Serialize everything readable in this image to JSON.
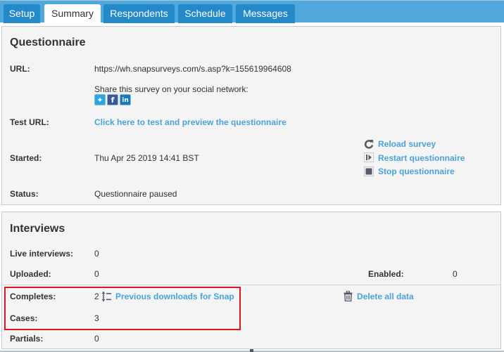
{
  "tabs": [
    {
      "label": "Setup",
      "active": false
    },
    {
      "label": "Summary",
      "active": true
    },
    {
      "label": "Respondents",
      "active": false
    },
    {
      "label": "Schedule",
      "active": false
    },
    {
      "label": "Messages",
      "active": false
    }
  ],
  "questionnaire": {
    "title": "Questionnaire",
    "url_label": "URL:",
    "url_value": "https://wh.snapsurveys.com/s.asp?k=155619964608",
    "share_text": "Share this survey on your social network:",
    "social": [
      "twitter-icon",
      "facebook-icon",
      "linkedin-icon"
    ],
    "test_url_label": "Test URL:",
    "test_url_link": "Click here to test and preview the questionnaire",
    "started_label": "Started:",
    "started_value": "Thu Apr 25 2019 14:41 BST",
    "status_label": "Status:",
    "status_value": "Questionnaire paused",
    "actions": {
      "reload": "Reload survey",
      "restart": "Restart questionnaire",
      "stop": "Stop questionnaire"
    }
  },
  "interviews": {
    "title": "Interviews",
    "live_label": "Live interviews:",
    "live_value": "0",
    "uploaded_label": "Uploaded:",
    "uploaded_value": "0",
    "enabled_label": "Enabled:",
    "enabled_value": "0",
    "completes_label": "Completes:",
    "completes_value": "2",
    "previous_downloads_link": "Previous downloads for Snap",
    "delete_link": "Delete all data",
    "cases_label": "Cases:",
    "cases_value": "3",
    "partials_label": "Partials:",
    "partials_value": "0"
  },
  "colors": {
    "tabbar": "#51a8dc",
    "tab": "#2389c8",
    "link": "#4aa3d8",
    "highlight": "#e0141e",
    "panel_bg": "#f4f4f4"
  }
}
